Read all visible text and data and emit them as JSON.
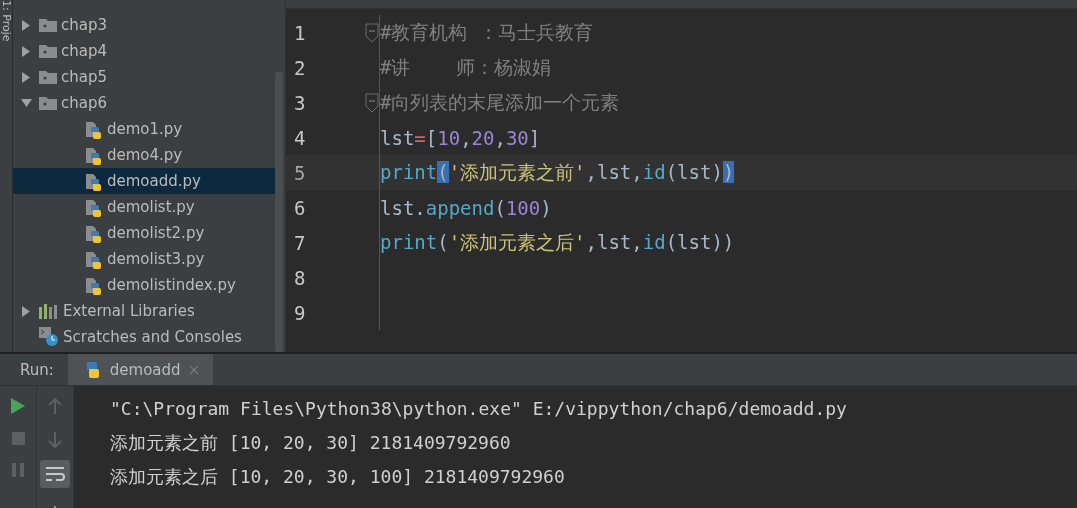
{
  "side_strip": {
    "label": "1: Proje"
  },
  "project_tree": [
    {
      "label": "chap3",
      "kind": "folder",
      "expanded": false,
      "selected": false
    },
    {
      "label": "chap4",
      "kind": "folder",
      "expanded": false,
      "selected": false
    },
    {
      "label": "chap5",
      "kind": "folder",
      "expanded": false,
      "selected": false
    },
    {
      "label": "chap6",
      "kind": "folder",
      "expanded": true,
      "selected": false,
      "children": [
        {
          "label": "demo1.py",
          "kind": "python",
          "selected": false
        },
        {
          "label": "demo4.py",
          "kind": "python",
          "selected": false
        },
        {
          "label": "demoadd.py",
          "kind": "python",
          "selected": true
        },
        {
          "label": "demolist.py",
          "kind": "python",
          "selected": false
        },
        {
          "label": "demolist2.py",
          "kind": "python",
          "selected": false
        },
        {
          "label": "demolist3.py",
          "kind": "python",
          "selected": false
        },
        {
          "label": "demolistindex.py",
          "kind": "python",
          "selected": false
        }
      ]
    },
    {
      "label": "External Libraries",
      "kind": "libraries",
      "expanded": false,
      "selected": false
    },
    {
      "label": "Scratches and Consoles",
      "kind": "scratches",
      "selected": false
    }
  ],
  "editor": {
    "lines": [
      {
        "number": "1",
        "current": false,
        "fold": true,
        "tokens": [
          {
            "text": "#教育机构 ：马士兵教育",
            "kind": "comment"
          }
        ]
      },
      {
        "number": "2",
        "current": false,
        "fold": false,
        "tokens": [
          {
            "text": "#讲    师：杨淑娟",
            "kind": "comment"
          }
        ]
      },
      {
        "number": "3",
        "current": false,
        "fold": true,
        "tokens": [
          {
            "text": "#向列表的末尾添加一个元素",
            "kind": "comment"
          }
        ]
      },
      {
        "number": "4",
        "current": false,
        "fold": false,
        "tokens": [
          {
            "text": "lst",
            "kind": "plain"
          },
          {
            "text": "=",
            "kind": "operator"
          },
          {
            "text": "[",
            "kind": "plain"
          },
          {
            "text": "10",
            "kind": "number"
          },
          {
            "text": ",",
            "kind": "plain"
          },
          {
            "text": "20",
            "kind": "number"
          },
          {
            "text": ",",
            "kind": "plain"
          },
          {
            "text": "30",
            "kind": "number"
          },
          {
            "text": "]",
            "kind": "plain"
          }
        ]
      },
      {
        "number": "5",
        "current": true,
        "fold": false,
        "tokens": [
          {
            "text": "print",
            "kind": "builtin"
          },
          {
            "text": "(",
            "kind": "bracket-match"
          },
          {
            "text": "'添加元素之前'",
            "kind": "string"
          },
          {
            "text": ",lst,",
            "kind": "plain"
          },
          {
            "text": "id",
            "kind": "builtin"
          },
          {
            "text": "(lst)",
            "kind": "plain"
          },
          {
            "text": ")",
            "kind": "bracket-match"
          }
        ]
      },
      {
        "number": "6",
        "current": false,
        "fold": false,
        "tokens": [
          {
            "text": "lst.",
            "kind": "plain"
          },
          {
            "text": "append",
            "kind": "builtin"
          },
          {
            "text": "(",
            "kind": "plain"
          },
          {
            "text": "100",
            "kind": "number"
          },
          {
            "text": ")",
            "kind": "plain"
          }
        ]
      },
      {
        "number": "7",
        "current": false,
        "fold": false,
        "tokens": [
          {
            "text": "print",
            "kind": "builtin"
          },
          {
            "text": "(",
            "kind": "plain"
          },
          {
            "text": "'添加元素之后'",
            "kind": "string"
          },
          {
            "text": ",lst,",
            "kind": "plain"
          },
          {
            "text": "id",
            "kind": "builtin"
          },
          {
            "text": "(lst))",
            "kind": "plain"
          }
        ]
      },
      {
        "number": "8",
        "current": false,
        "fold": false
      },
      {
        "number": "9",
        "current": false,
        "fold": false
      }
    ]
  },
  "run_panel": {
    "label": "Run:",
    "tabs": [
      {
        "label": "demoadd",
        "selected": true
      }
    ],
    "output": [
      "\"C:\\Program Files\\Python38\\python.exe\" E:/vippython/chap6/demoadd.py",
      "添加元素之前 [10, 20, 30] 2181409792960",
      "添加元素之后 [10, 20, 30, 100] 2181409792960"
    ]
  }
}
